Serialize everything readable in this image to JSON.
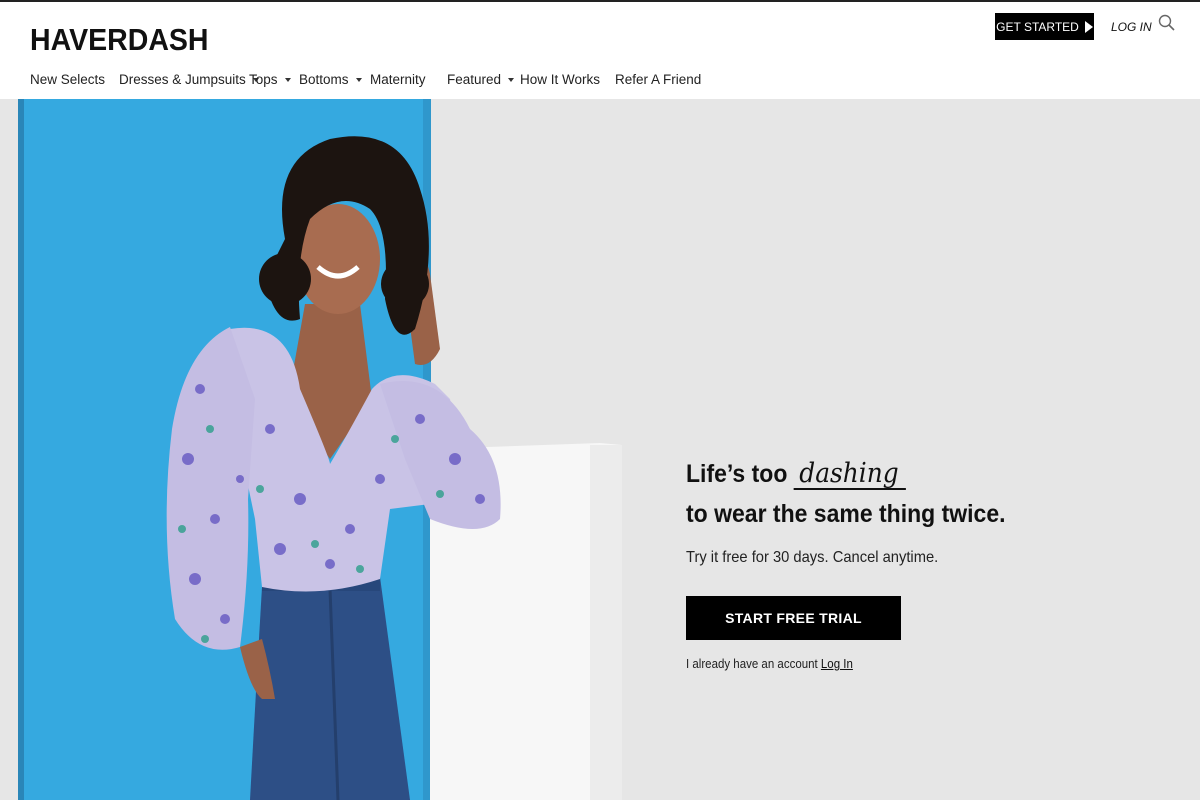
{
  "brand": {
    "logo_text": "HAVERDASH"
  },
  "header": {
    "get_started_label": "GET STARTED",
    "login_label": "LOG IN",
    "icons": {
      "play": "play-icon",
      "search": "search-icon",
      "dropdown": "caret-icon"
    }
  },
  "nav": {
    "items": [
      {
        "label": "New Selects",
        "has_dropdown": false
      },
      {
        "label": "Dresses & Jumpsuits",
        "has_dropdown": true
      },
      {
        "label": "Tops",
        "has_dropdown": true
      },
      {
        "label": "Bottoms",
        "has_dropdown": true
      },
      {
        "label": "Maternity",
        "has_dropdown": false
      },
      {
        "label": "Featured",
        "has_dropdown": true
      },
      {
        "label": "How It Works",
        "has_dropdown": false
      },
      {
        "label": "Refer A Friend",
        "has_dropdown": false
      }
    ]
  },
  "hero": {
    "headline_prefix": "Life’s too",
    "headline_script": "dashing",
    "headline_line2": "to wear the same thing twice.",
    "subline": "Try it free for 30 days. Cancel anytime.",
    "cta_label": "START FREE TRIAL",
    "account_text": "I already have an account",
    "account_link": "Log In"
  },
  "colors": {
    "accent_blue": "#35a9e0",
    "button_black": "#000000",
    "hero_background": "#e6e6e6"
  }
}
